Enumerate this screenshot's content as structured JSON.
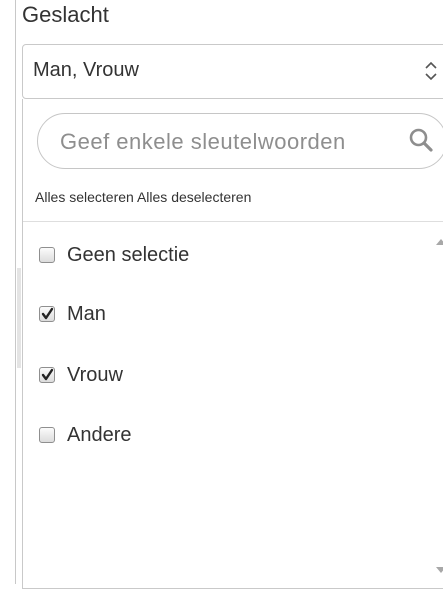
{
  "field": {
    "label": "Geslacht",
    "selected_value": "Man, Vrouw"
  },
  "dropdown": {
    "search_placeholder": "Geef enkele sleutelwoorden",
    "select_all_label": "Alles selecteren",
    "deselect_all_label": "Alles deselecteren",
    "options": [
      {
        "label": "Geen selectie",
        "checked": false
      },
      {
        "label": "Man",
        "checked": true
      },
      {
        "label": "Vrouw",
        "checked": true
      },
      {
        "label": "Andere",
        "checked": false
      }
    ]
  },
  "icons": {
    "caret": "up-down-caret-icon",
    "search": "search-icon",
    "check": "checkmark-icon",
    "scroll_up": "scroll-up-arrow-icon",
    "scroll_down": "scroll-down-arrow-icon"
  },
  "colors": {
    "text": "#333333",
    "border": "#c9c9c9",
    "placeholder": "#8e8e8e"
  }
}
